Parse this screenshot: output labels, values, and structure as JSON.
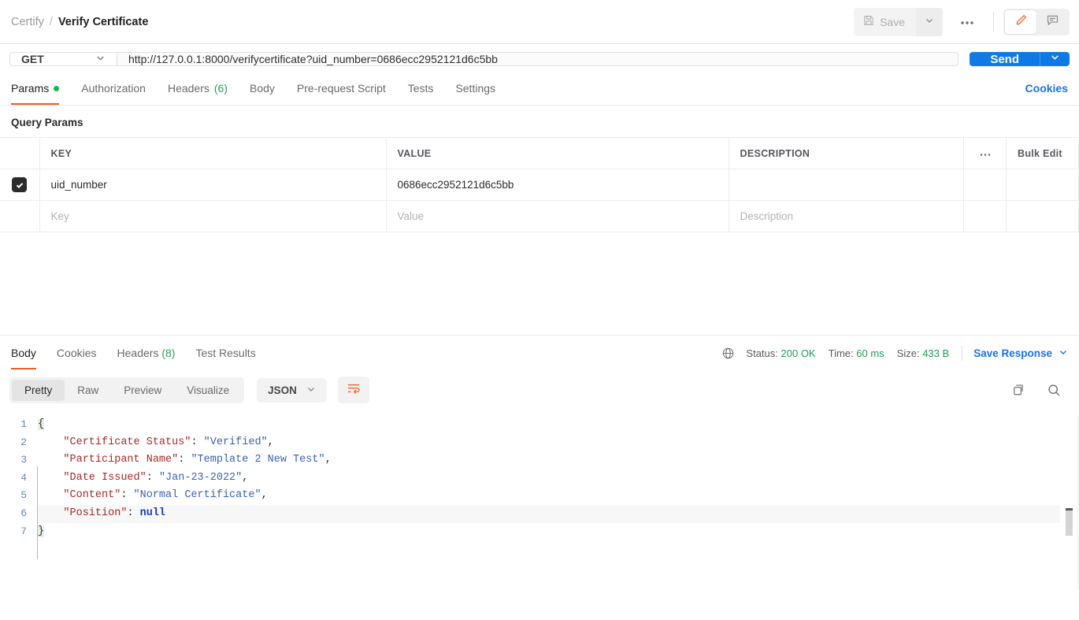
{
  "theme": {
    "accent_orange": "#ef5b25",
    "link_blue": "#1a73e8",
    "send_blue": "#0f7ae5",
    "status_green": "#1f9d55",
    "dot_green": "#1bb450"
  },
  "topbar": {
    "breadcrumb": {
      "collection": "Certify",
      "separator": "/",
      "request": "Verify Certificate"
    },
    "save_label": "Save",
    "save_icon": "floppy-disk-icon",
    "save_caret_icon": "chevron-down-icon",
    "more_label": "●●●",
    "more_icon": "ellipsis-icon",
    "edit_icon": "pencil-icon",
    "comment_icon": "comment-icon"
  },
  "request": {
    "method": "GET",
    "method_caret_icon": "chevron-down-icon",
    "url": "http://127.0.0.1:8000/verifycertificate?uid_number=0686ecc2952121d6c5bb",
    "send_label": "Send",
    "send_caret_icon": "chevron-down-icon"
  },
  "request_tabs": {
    "items": [
      {
        "label": "Params",
        "active": true,
        "dot": true
      },
      {
        "label": "Authorization",
        "active": false
      },
      {
        "label": "Headers",
        "count": "(6)",
        "active": false
      },
      {
        "label": "Body",
        "active": false
      },
      {
        "label": "Pre-request Script",
        "active": false
      },
      {
        "label": "Tests",
        "active": false
      },
      {
        "label": "Settings",
        "active": false
      }
    ],
    "cookies_link": "Cookies"
  },
  "query_params": {
    "section_title": "Query Params",
    "columns": [
      "KEY",
      "VALUE",
      "DESCRIPTION"
    ],
    "more_icon": "ellipsis-icon",
    "bulk_edit_label": "Bulk Edit",
    "rows": [
      {
        "checked": true,
        "key": "uid_number",
        "value": "0686ecc2952121d6c5bb",
        "description": ""
      }
    ],
    "placeholders": {
      "key": "Key",
      "value": "Value",
      "description": "Description"
    }
  },
  "response": {
    "tabs": [
      {
        "label": "Body",
        "active": true
      },
      {
        "label": "Cookies",
        "active": false
      },
      {
        "label": "Headers",
        "count": "(8)",
        "active": false
      },
      {
        "label": "Test Results",
        "active": false
      }
    ],
    "network_icon": "globe-icon",
    "status_label": "Status:",
    "status_value": "200 OK",
    "time_label": "Time:",
    "time_value": "60 ms",
    "size_label": "Size:",
    "size_value": "433 B",
    "save_response_label": "Save Response",
    "save_response_caret_icon": "chevron-down-icon",
    "view_modes": [
      {
        "label": "Pretty",
        "active": true
      },
      {
        "label": "Raw",
        "active": false
      },
      {
        "label": "Preview",
        "active": false
      },
      {
        "label": "Visualize",
        "active": false
      }
    ],
    "format": "JSON",
    "format_caret_icon": "chevron-down-icon",
    "wrap_icon": "word-wrap-icon",
    "copy_icon": "copy-icon",
    "search_icon": "search-icon",
    "body": {
      "line_numbers": [
        "1",
        "2",
        "3",
        "4",
        "5",
        "6",
        "7"
      ],
      "lines": [
        {
          "n": "1",
          "open_brace": "{"
        },
        {
          "n": "2",
          "key": "\"Certificate Status\"",
          "colon": ": ",
          "value": "\"Verified\"",
          "value_type": "string",
          "comma": ","
        },
        {
          "n": "3",
          "key": "\"Participant Name\"",
          "colon": ": ",
          "value": "\"Template 2 New Test\"",
          "value_type": "string",
          "comma": ","
        },
        {
          "n": "4",
          "key": "\"Date Issued\"",
          "colon": ": ",
          "value": "\"Jan-23-2022\"",
          "value_type": "string",
          "comma": ","
        },
        {
          "n": "5",
          "key": "\"Content\"",
          "colon": ": ",
          "value": "\"Normal Certificate\"",
          "value_type": "string",
          "comma": ","
        },
        {
          "n": "6",
          "key": "\"Position\"",
          "colon": ": ",
          "value": "null",
          "value_type": "null",
          "comma": ""
        },
        {
          "n": "7",
          "close_brace": "}"
        }
      ],
      "parsed": {
        "Certificate Status": "Verified",
        "Participant Name": "Template 2 New Test",
        "Date Issued": "Jan-23-2022",
        "Content": "Normal Certificate",
        "Position": null
      }
    }
  }
}
